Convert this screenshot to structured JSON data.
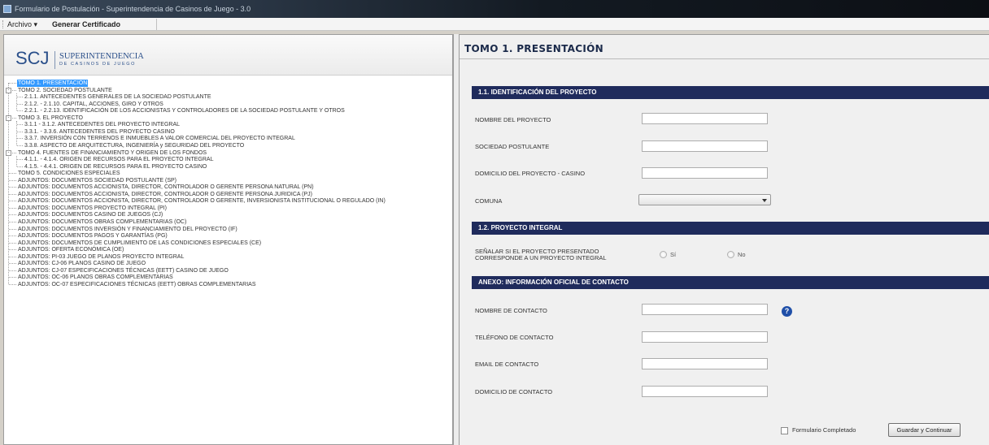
{
  "window": {
    "title": "Formulario de Postulación - Superintendencia de Casinos de Juego - 3.0"
  },
  "menu": {
    "archivo": "Archivo",
    "generar": "Generar Certificado"
  },
  "logo": {
    "mark": "SCJ",
    "main": "SUPERINTENDENCIA",
    "sub": "DE CASINOS DE JUEGO"
  },
  "tree": [
    {
      "text": "TOMO 1. PRESENTACIÓN",
      "level": 0,
      "selected": true
    },
    {
      "text": "TOMO 2. SOCIEDAD POSTULANTE",
      "level": 0,
      "expander": "-"
    },
    {
      "text": "2.1.1. ANTECEDENTES GENERALES DE LA SOCIEDAD POSTULANTE",
      "level": 1
    },
    {
      "text": "2.1.2. - 2.1.10. CAPITAL, ACCIONES, GIRO Y OTROS",
      "level": 1
    },
    {
      "text": "2.2.1. - 2.2.13. IDENTIFICACIÓN DE LOS ACCIONISTAS Y CONTROLADORES DE LA SOCIEDAD POSTULANTE Y OTROS",
      "level": 1
    },
    {
      "text": "TOMO 3. EL PROYECTO",
      "level": 0,
      "expander": "-"
    },
    {
      "text": "3.1.1 - 3.1.2. ANTECEDENTES DEL PROYECTO INTEGRAL",
      "level": 1
    },
    {
      "text": "3.3.1. - 3.3.6. ANTECEDENTES DEL PROYECTO CASINO",
      "level": 1
    },
    {
      "text": "3.3.7. INVERSIÓN CON TERRENOS E INMUEBLES A VALOR COMERCIAL DEL PROYECTO INTEGRAL",
      "level": 1
    },
    {
      "text": "3.3.8. ASPECTO DE ARQUITECTURA, INGENIERÍA y SEGURIDAD DEL PROYECTO",
      "level": 1
    },
    {
      "text": "TOMO 4. FUENTES DE FINANCIAMIENTO Y ORIGEN DE LOS FONDOS",
      "level": 0,
      "expander": "-"
    },
    {
      "text": "4.1.1. - 4.1.4. ORIGEN DE RECURSOS PARA EL PROYECTO INTEGRAL",
      "level": 1
    },
    {
      "text": "4.1.5. - 4.4.1. ORIGEN DE RECURSOS PARA EL PROYECTO CASINO",
      "level": 1
    },
    {
      "text": "TOMO 5. CONDICIONES ESPECIALES",
      "level": 0
    },
    {
      "text": "ADJUNTOS: DOCUMENTOS SOCIEDAD POSTULANTE (SP)",
      "level": 0
    },
    {
      "text": "ADJUNTOS: DOCUMENTOS ACCIONISTA, DIRECTOR, CONTROLADOR O GERENTE PERSONA NATURAL (PN)",
      "level": 0
    },
    {
      "text": "ADJUNTOS: DOCUMENTOS ACCIONISTA, DIRECTOR, CONTROLADOR O GERENTE PERSONA JURIDICA (PJ)",
      "level": 0
    },
    {
      "text": "ADJUNTOS: DOCUMENTOS ACCIONISTA, DIRECTOR, CONTROLADOR O GERENTE, INVERSIONISTA INSTITUCIONAL O REGULADO (IN)",
      "level": 0
    },
    {
      "text": "ADJUNTOS: DOCUMENTOS PROYECTO INTEGRAL (PI)",
      "level": 0
    },
    {
      "text": "ADJUNTOS: DOCUMENTOS CASINO DE JUEGOS (CJ)",
      "level": 0
    },
    {
      "text": "ADJUNTOS: DOCUMENTOS OBRAS COMPLEMENTARIAS (OC)",
      "level": 0
    },
    {
      "text": "ADJUNTOS: DOCUMENTOS INVERSIÓN Y FINANCIAMIENTO DEL PROYECTO (IF)",
      "level": 0
    },
    {
      "text": "ADJUNTOS: DOCUMENTOS PAGOS Y GARANTÍAS (PG)",
      "level": 0
    },
    {
      "text": "ADJUNTOS: DOCUMENTOS DE CUMPLIMIENTO DE LAS CONDICIONES ESPECIALES (CE)",
      "level": 0
    },
    {
      "text": "ADJUNTOS: OFERTA ECONÓMICA (OE)",
      "level": 0
    },
    {
      "text": "ADJUNTOS: PI-03 JUEGO DE PLANOS PROYECTO INTEGRAL",
      "level": 0
    },
    {
      "text": "ADJUNTOS: CJ-06 PLANOS CASINO DE JUEGO",
      "level": 0
    },
    {
      "text": "ADJUNTOS: CJ-07 ESPECIFICACIONES TÉCNICAS (EETT) CASINO DE JUEGO",
      "level": 0
    },
    {
      "text": "ADJUNTOS: OC-06 PLANOS OBRAS COMPLEMENTARIAS",
      "level": 0
    },
    {
      "text": "ADJUNTOS: OC-07 ESPECIFICACIONES TÉCNICAS (EETT) OBRAS COMPLEMENTARIAS",
      "level": 0
    }
  ],
  "main": {
    "title": "TOMO 1.  PRESENTACIÓN",
    "sections": {
      "identificacion": "1.1. IDENTIFICACIÓN DEL PROYECTO",
      "integral": "1.2. PROYECTO INTEGRAL",
      "anexo": "ANEXO: INFORMACIÓN OFICIAL DE CONTACTO"
    },
    "fields": {
      "nombre_proyecto": {
        "label": "NOMBRE DEL PROYECTO",
        "value": ""
      },
      "sociedad": {
        "label": "SOCIEDAD POSTULANTE",
        "value": ""
      },
      "domicilio_proyecto": {
        "label": "DOMICILIO DEL PROYECTO - CASINO",
        "value": ""
      },
      "comuna": {
        "label": "COMUNA",
        "value": ""
      },
      "senalar_line1": "SEÑALAR SI EL PROYECTO PRESENTADO",
      "senalar_line2": "CORRESPONDE A UN PROYECTO INTEGRAL",
      "radio_si": "Sí",
      "radio_no": "No",
      "nombre_contacto": {
        "label": "NOMBRE DE CONTACTO",
        "value": ""
      },
      "telefono_contacto": {
        "label": "TELÉFONO DE CONTACTO",
        "value": ""
      },
      "email_contacto": {
        "label": "EMAIL DE CONTACTO",
        "value": ""
      },
      "domicilio_contacto": {
        "label": "DOMICILIO DE CONTACTO",
        "value": ""
      }
    },
    "help_glyph": "?",
    "checkbox_label": "Formulario Completado",
    "save_button": "Guardar y Continuar"
  }
}
